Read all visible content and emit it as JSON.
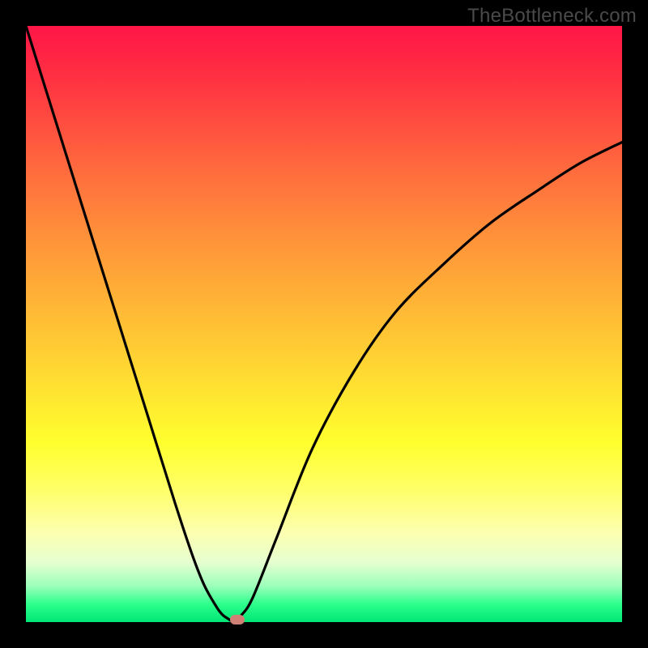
{
  "watermark": "TheBottleneck.com",
  "chart_data": {
    "type": "line",
    "title": "",
    "xlabel": "",
    "ylabel": "",
    "xlim": [
      0,
      100
    ],
    "ylim": [
      0,
      100
    ],
    "series": [
      {
        "name": "bottleneck-curve",
        "x": [
          0,
          5,
          10,
          15,
          20,
          25,
          28,
          30,
          32,
          33,
          34,
          34.5,
          35,
          36,
          38,
          42,
          48,
          55,
          62,
          70,
          78,
          86,
          93,
          100
        ],
        "values": [
          100,
          84,
          68,
          52,
          36,
          20,
          11,
          6,
          2.5,
          1.2,
          0.5,
          0.2,
          0.2,
          1.0,
          4,
          14,
          29,
          42,
          52,
          60,
          67,
          72.5,
          77,
          80.5
        ]
      }
    ],
    "marker": {
      "x": 35.5,
      "y": 0.4,
      "color": "#d08074"
    },
    "background_gradient": {
      "top": "#ff1648",
      "mid": "#ffd932",
      "bottom": "#00e676"
    }
  }
}
